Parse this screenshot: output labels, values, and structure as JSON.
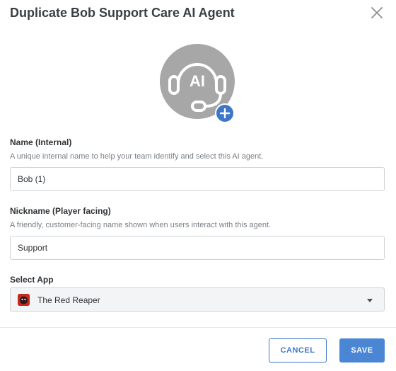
{
  "dialog": {
    "title": "Duplicate Bob Support Care AI Agent"
  },
  "avatar": {
    "badge_text": "AI",
    "icon": "headset-icon",
    "add_icon": "plus-icon",
    "colors": {
      "circle": "#a7a7a7",
      "add": "#3f77c8"
    }
  },
  "name_field": {
    "label": "Name (Internal)",
    "help": "A unique internal name to help your team identify and select this AI agent.",
    "value": "Bob (1)"
  },
  "nickname_field": {
    "label": "Nickname (Player facing)",
    "help": "A friendly, customer-facing name shown when users interact with this agent.",
    "value": "Support"
  },
  "app_select": {
    "label": "Select App",
    "selected": "The Red Reaper",
    "icon": "app-logo-icon"
  },
  "footer": {
    "cancel_label": "CANCEL",
    "save_label": "SAVE",
    "colors": {
      "primary": "#4a86d4",
      "outline": "#3f77c8"
    }
  }
}
